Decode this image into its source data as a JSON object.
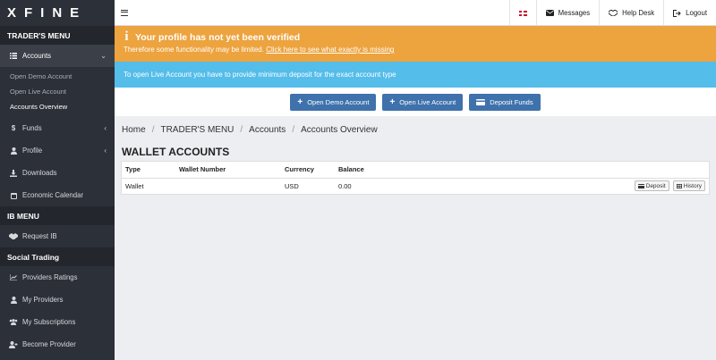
{
  "brand": {
    "logo": "XFINE"
  },
  "sidebar": {
    "traders_menu_header": "TRADER'S MENU",
    "accounts": {
      "label": "Accounts",
      "icon": "list-icon"
    },
    "accounts_sub": [
      "Open Demo Account",
      "Open Live Account",
      "Accounts Overview"
    ],
    "funds": {
      "label": "Funds",
      "icon": "dollar-icon"
    },
    "profile": {
      "label": "Profile",
      "icon": "user-icon"
    },
    "downloads": {
      "label": "Downloads",
      "icon": "download-icon"
    },
    "economic_calendar": {
      "label": "Economic Calendar",
      "icon": "calendar-icon"
    },
    "ib_menu_header": "IB MENU",
    "request_ib": {
      "label": "Request IB",
      "icon": "handshake-icon"
    },
    "social_header": "Social Trading",
    "providers_ratings": {
      "label": "Providers Ratings",
      "icon": "chart-line-icon"
    },
    "my_providers": {
      "label": "My Providers",
      "icon": "user-tie-icon"
    },
    "my_subscriptions": {
      "label": "My Subscriptions",
      "icon": "users-icon"
    },
    "become_provider": {
      "label": "Become Provider",
      "icon": "user-plus-icon"
    }
  },
  "topbar": {
    "messages": "Messages",
    "help_desk": "Help Desk",
    "logout": "Logout"
  },
  "warning": {
    "title": "Your profile has not yet been verified",
    "text": "Therefore some functionality may be limited.",
    "link": "Click here to see what exactly is missing"
  },
  "info": {
    "text": "To open Live Account you have to provide minimum deposit for the exact account type"
  },
  "actions": {
    "open_demo": "Open Demo Account",
    "open_live": "Open Live Account",
    "deposit_funds": "Deposit Funds"
  },
  "breadcrumb": [
    "Home",
    "TRADER'S MENU",
    "Accounts",
    "Accounts Overview"
  ],
  "page_title": "WALLET ACCOUNTS",
  "table": {
    "headers": [
      "Type",
      "Wallet Number",
      "Currency",
      "Balance"
    ],
    "rows": [
      {
        "type": "Wallet",
        "wallet_number": "",
        "currency": "USD",
        "balance": "0.00",
        "deposit": "Deposit",
        "history": "History"
      }
    ]
  },
  "colors": {
    "warning": "#eda33e",
    "info": "#54bde9",
    "button": "#3f72ac",
    "sidebar": "#2c3038"
  }
}
